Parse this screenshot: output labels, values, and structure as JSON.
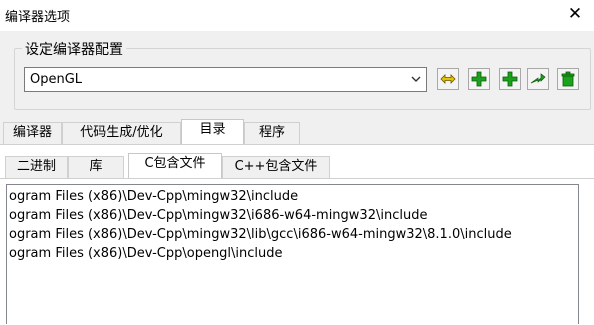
{
  "window": {
    "title": "编译器选项",
    "close_symbol": "✕"
  },
  "config_group": {
    "legend": "设定编译器配置",
    "selected_profile": "OpenGL",
    "buttons": [
      "rename-profile",
      "add-profile",
      "add-profile-copy",
      "export-profile",
      "delete-profile"
    ]
  },
  "main_tabs": [
    {
      "label": "编译器",
      "active": false
    },
    {
      "label": "代码生成/优化",
      "active": false
    },
    {
      "label": "目录",
      "active": true
    },
    {
      "label": "程序",
      "active": false
    }
  ],
  "sub_tabs": [
    {
      "label": "二进制",
      "active": false
    },
    {
      "label": "库",
      "active": false
    },
    {
      "label": "C包含文件",
      "active": true
    },
    {
      "label": "C++包含文件",
      "active": false
    }
  ],
  "include_dirs": [
    "ogram Files (x86)\\Dev-Cpp\\mingw32\\include",
    "ogram Files (x86)\\Dev-Cpp\\mingw32\\i686-w64-mingw32\\include",
    "ogram Files (x86)\\Dev-Cpp\\mingw32\\lib\\gcc\\i686-w64-mingw32\\8.1.0\\include",
    "ogram Files (x86)\\Dev-Cpp\\opengl\\include"
  ],
  "colors": {
    "accent_green": "#1aa21a",
    "accent_yellow": "#e6c400"
  }
}
